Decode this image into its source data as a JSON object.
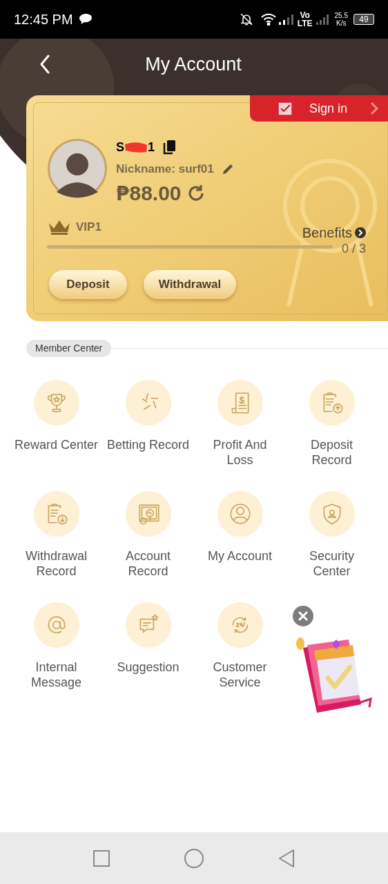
{
  "status_bar": {
    "time": "12:45 PM",
    "volte_top": "Vo",
    "volte_bottom": "LTE",
    "speed_value": "25.5",
    "speed_unit": "K/s",
    "battery": "49"
  },
  "header": {
    "title": "My Account"
  },
  "account_card": {
    "sign_in": "Sign in",
    "username_start": "S",
    "username_end": "1",
    "nickname": "Nickname: surf01",
    "currency": "₱",
    "balance": "88.00",
    "vip": "VIP1",
    "benefits": "Benefits",
    "progress_text": "0 / 3",
    "level": 0,
    "buttons": [
      "Deposit",
      "Withdrawal"
    ]
  },
  "section": {
    "title": "Member Center"
  },
  "menu": [
    {
      "label": "Reward Center"
    },
    {
      "label": "Betting Record"
    },
    {
      "label": "Profit And Loss"
    },
    {
      "label": "Deposit Record"
    },
    {
      "label": "Withdrawal Record"
    },
    {
      "label": "Account Record"
    },
    {
      "label": "My Account"
    },
    {
      "label": "Security Center"
    },
    {
      "label": "Internal Message"
    },
    {
      "label": "Suggestion"
    },
    {
      "label": "Customer Service"
    }
  ]
}
